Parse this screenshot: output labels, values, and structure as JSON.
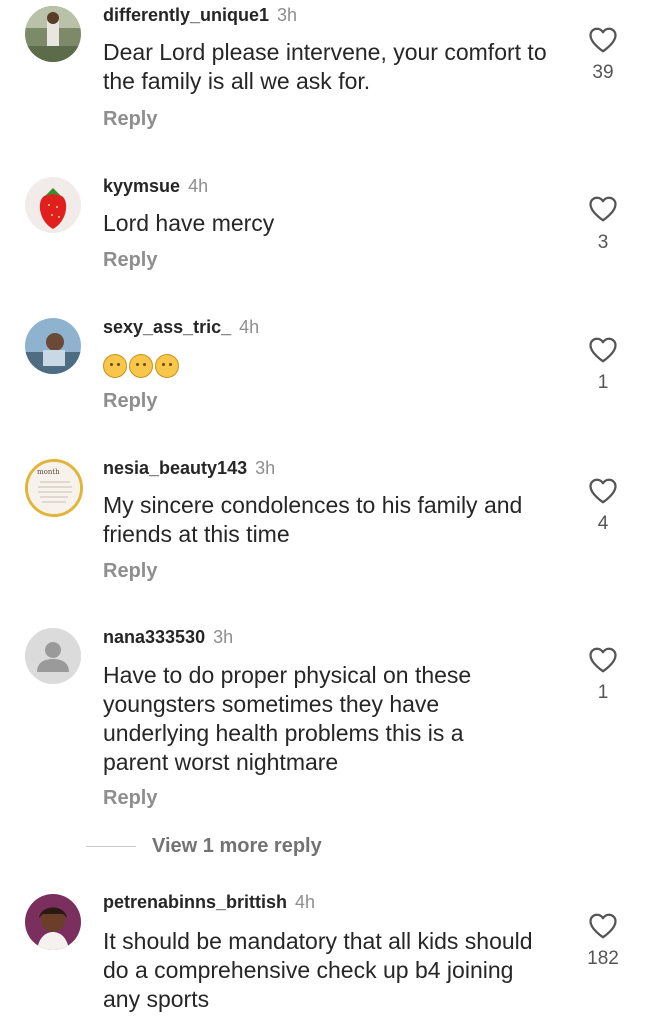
{
  "comments": [
    {
      "username": "differently_unique1",
      "time": "3h",
      "text": "Dear Lord please intervene, your comfort to the family is all we ask for.",
      "reply": "Reply",
      "likes": "39",
      "avatar": "photo"
    },
    {
      "username": "kyymsue",
      "time": "4h",
      "text": "Lord have mercy",
      "reply": "Reply",
      "likes": "3",
      "avatar": "strawberry"
    },
    {
      "username": "sexy_ass_tric_",
      "time": "4h",
      "text": "",
      "reply": "Reply",
      "likes": "1",
      "avatar": "photo",
      "emoji": "crying-face x3"
    },
    {
      "username": "nesia_beauty143",
      "time": "3h",
      "text": "My sincere condolences to his family and friends at this time",
      "reply": "Reply",
      "likes": "4",
      "avatar": "month-card"
    },
    {
      "username": "nana333530",
      "time": "3h",
      "text": "Have to do proper physical on these youngsters sometimes they have underlying health problems this is a parent worst nightmare",
      "reply": "Reply",
      "likes": "1",
      "avatar": "default-person"
    },
    {
      "username": "petrenabinns_brittish",
      "time": "4h",
      "text": "It should be mandatory that all kids should do a comprehensive check up b4 joining any sports",
      "reply": "",
      "likes": "182",
      "avatar": "photo"
    }
  ],
  "view_more": "View 1 more reply",
  "avatar_badge": "month"
}
